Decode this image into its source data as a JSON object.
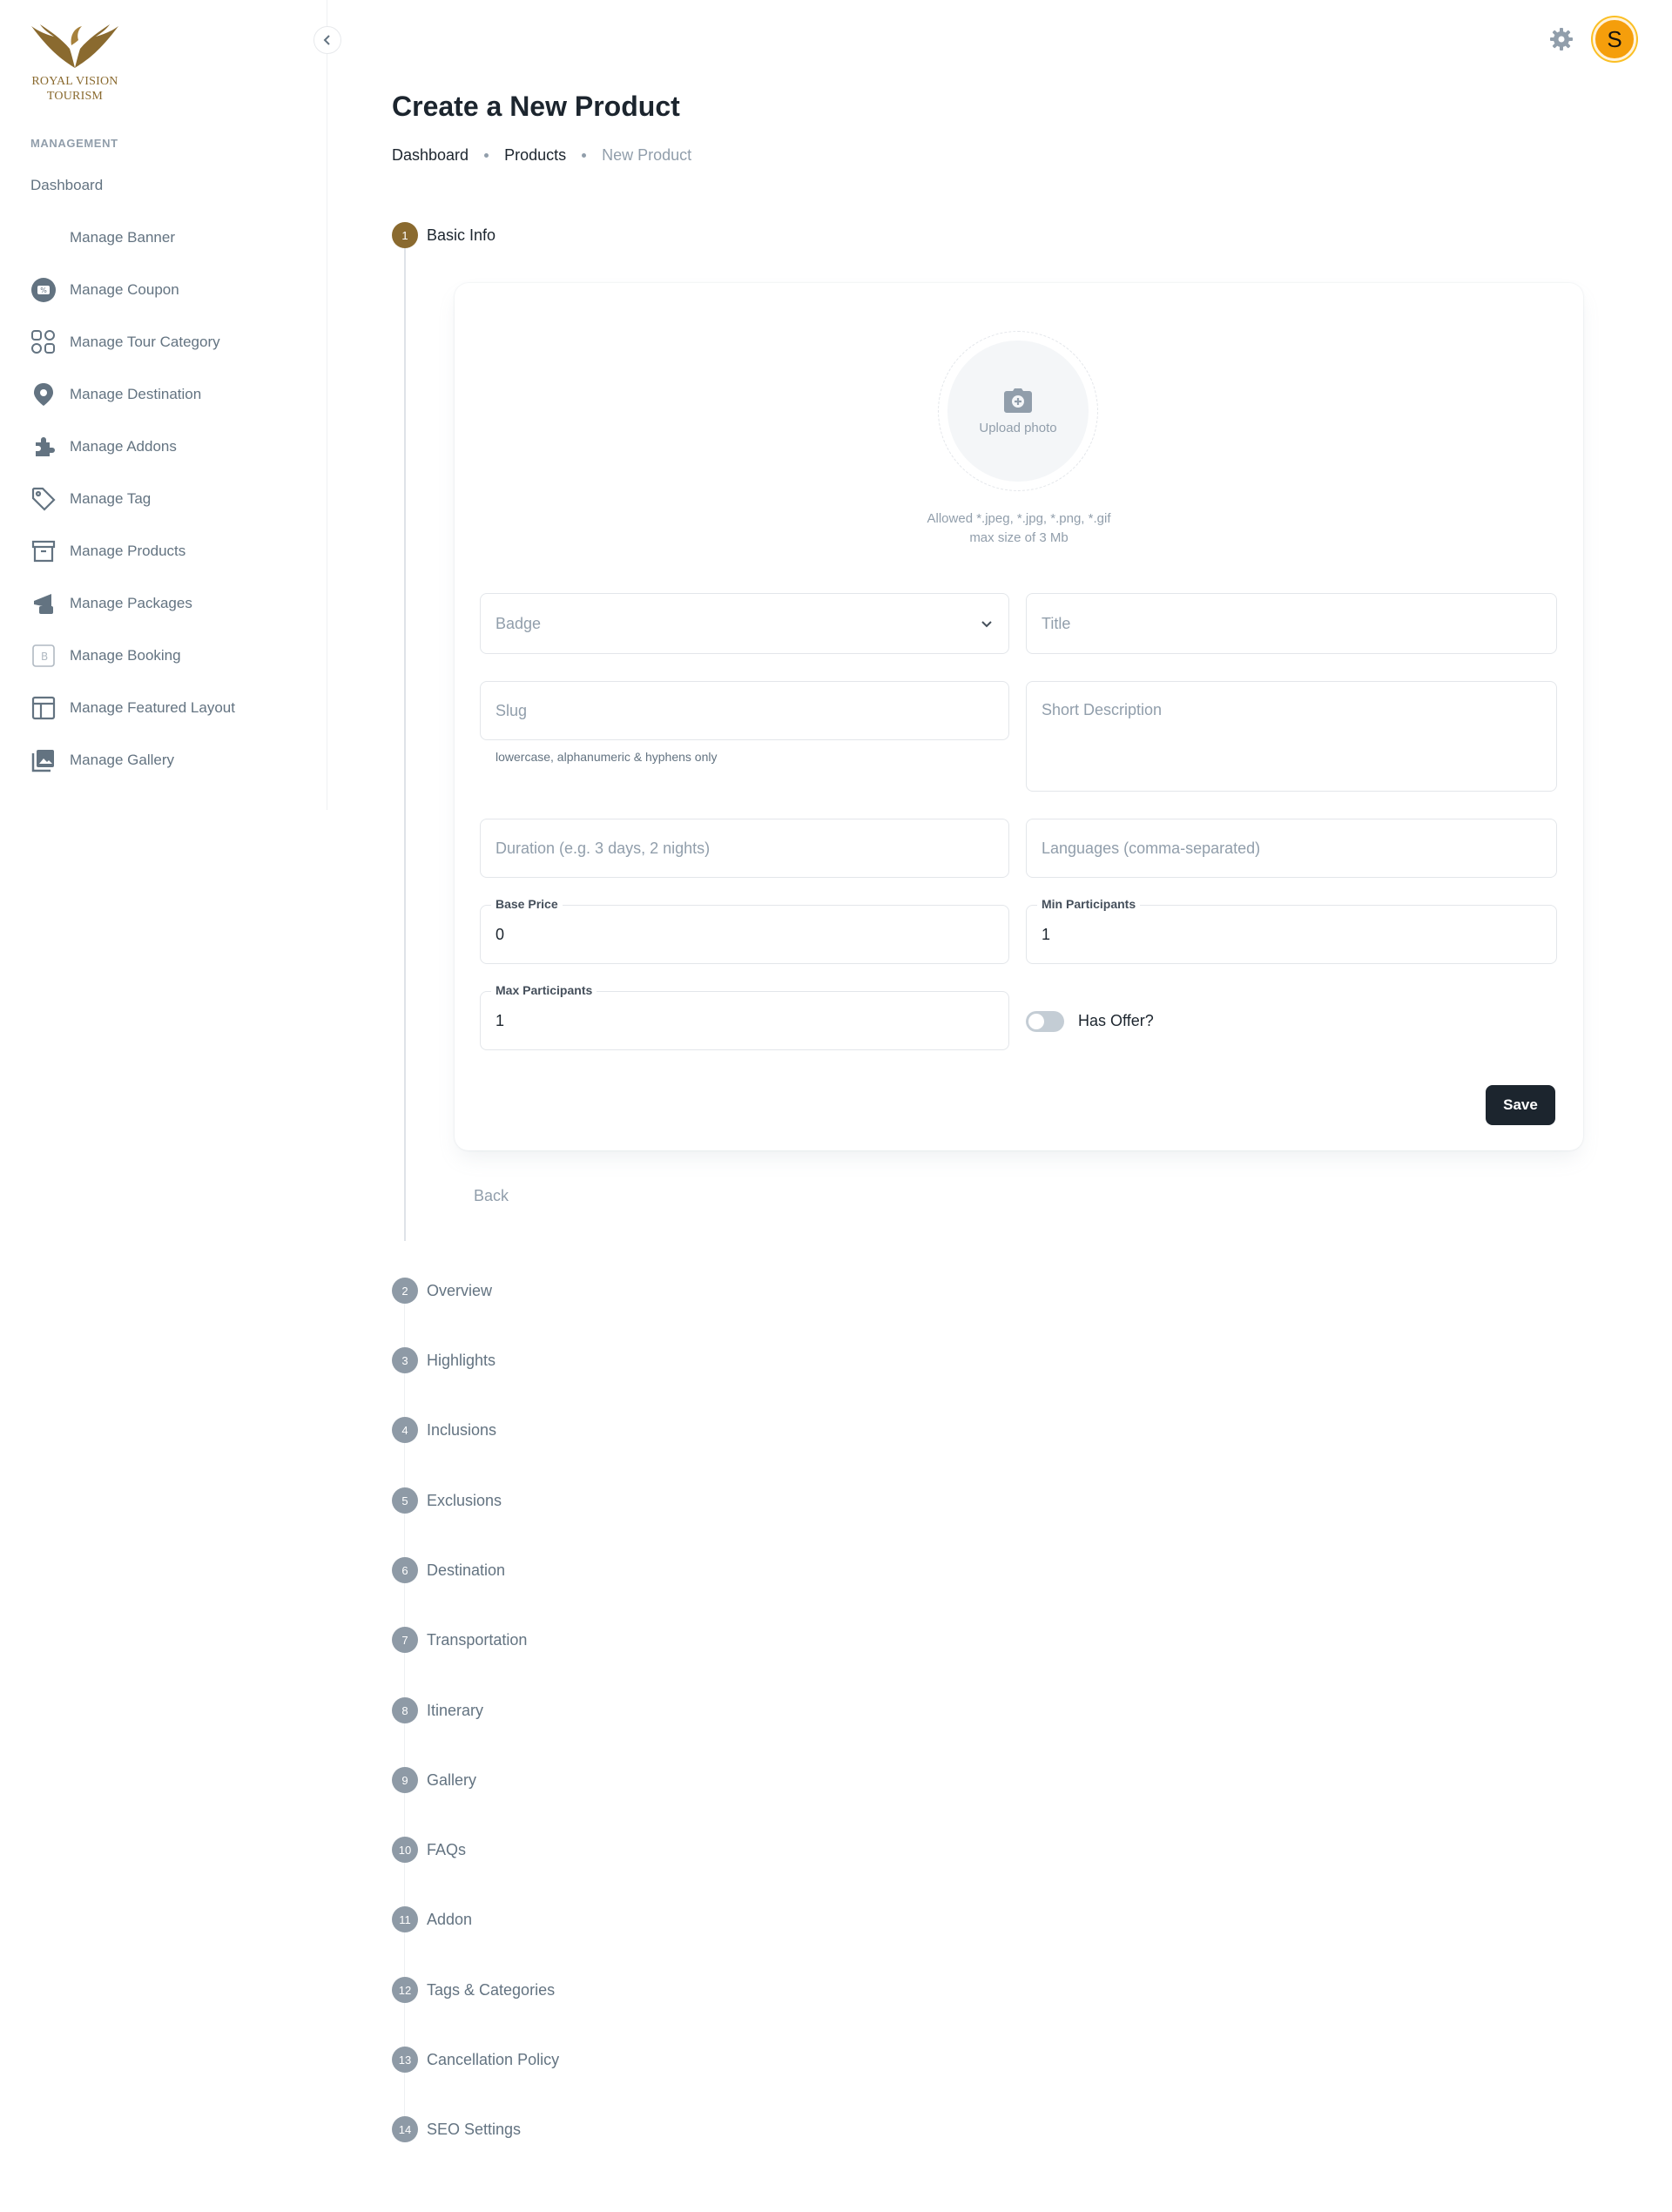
{
  "brand": {
    "line1": "ROYAL VISION",
    "line2": "TOURISM",
    "gold": "#8a6a2f"
  },
  "sidebar": {
    "subheader": "MANAGEMENT",
    "items": [
      {
        "label": "Dashboard",
        "icon": "none"
      },
      {
        "label": "Manage Banner",
        "icon": "none"
      },
      {
        "label": "Manage Coupon",
        "icon": "coupon-icon"
      },
      {
        "label": "Manage Tour Category",
        "icon": "category-icon"
      },
      {
        "label": "Manage Destination",
        "icon": "location-pin-icon"
      },
      {
        "label": "Manage Addons",
        "icon": "puzzle-icon"
      },
      {
        "label": "Manage Tag",
        "icon": "tag-icon"
      },
      {
        "label": "Manage Products",
        "icon": "archive-box-icon"
      },
      {
        "label": "Manage Packages",
        "icon": "package-icon"
      },
      {
        "label": "Manage Booking",
        "icon": "booking-icon"
      },
      {
        "label": "Manage Featured Layout",
        "icon": "layout-icon"
      },
      {
        "label": "Manage Gallery",
        "icon": "gallery-icon"
      }
    ]
  },
  "header": {
    "avatar_initial": "S",
    "avatar_color": "#f59e0b",
    "title": "Create a New Product",
    "breadcrumb": [
      "Dashboard",
      "Products",
      "New Product"
    ]
  },
  "steps": [
    {
      "num": "1",
      "label": "Basic Info"
    },
    {
      "num": "2",
      "label": "Overview"
    },
    {
      "num": "3",
      "label": "Highlights"
    },
    {
      "num": "4",
      "label": "Inclusions"
    },
    {
      "num": "5",
      "label": "Exclusions"
    },
    {
      "num": "6",
      "label": "Destination"
    },
    {
      "num": "7",
      "label": "Transportation"
    },
    {
      "num": "8",
      "label": "Itinerary"
    },
    {
      "num": "9",
      "label": "Gallery"
    },
    {
      "num": "10",
      "label": "FAQs"
    },
    {
      "num": "11",
      "label": "Addon"
    },
    {
      "num": "12",
      "label": "Tags & Categories"
    },
    {
      "num": "13",
      "label": "Cancellation Policy"
    },
    {
      "num": "14",
      "label": "SEO Settings"
    }
  ],
  "form": {
    "upload_label": "Upload photo",
    "allowed_line1": "Allowed *.jpeg, *.jpg, *.png, *.gif",
    "allowed_line2": "max size of 3 Mb",
    "badge_placeholder": "Badge",
    "title_placeholder": "Title",
    "slug_placeholder": "Slug",
    "slug_helper": "lowercase, alphanumeric & hyphens only",
    "short_desc_placeholder": "Short Description",
    "duration_placeholder": "Duration (e.g. 3 days, 2 nights)",
    "languages_placeholder": "Languages (comma-separated)",
    "base_price_label": "Base Price",
    "base_price_value": "0",
    "min_participants_label": "Min Participants",
    "min_participants_value": "1",
    "max_participants_label": "Max Participants",
    "max_participants_value": "1",
    "has_offer_label": "Has Offer?",
    "save_label": "Save",
    "back_label": "Back"
  }
}
